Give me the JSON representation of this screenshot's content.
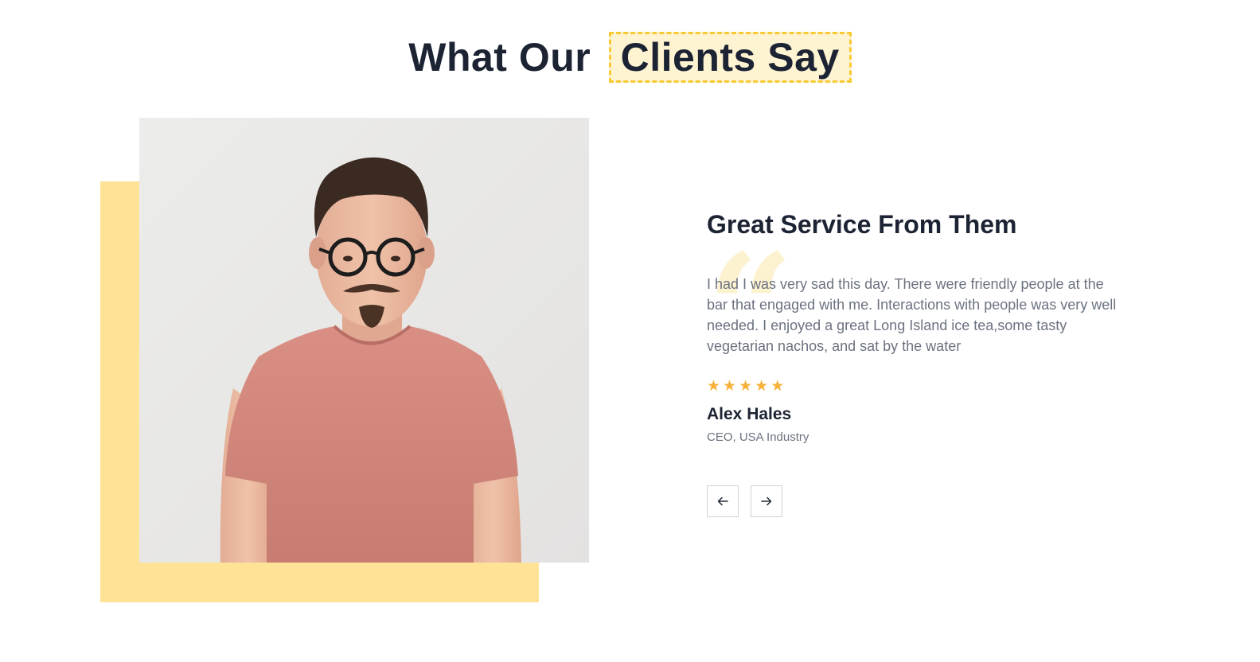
{
  "section": {
    "heading_plain": "What Our",
    "heading_highlight": "Clients Say"
  },
  "testimonial": {
    "title": "Great Service From Them",
    "quote_glyph": "“",
    "text": "I had I was very sad this day. There were friendly people at the bar that engaged with me. Interactions with people was very well needed. I enjoyed a great Long Island ice tea,some tasty vegetarian nachos, and sat by the water",
    "rating": 5,
    "star_glyph": "★",
    "author_name": "Alex Hales",
    "author_role": "CEO, USA Industry"
  },
  "navigation": {
    "prev_icon": "arrow-left-icon",
    "next_icon": "arrow-right-icon"
  },
  "colors": {
    "accent_yellow": "#fee397",
    "highlight_border": "#f9c934",
    "star": "#f7b23b",
    "heading": "#1c2333",
    "body_text": "#6b7280"
  }
}
